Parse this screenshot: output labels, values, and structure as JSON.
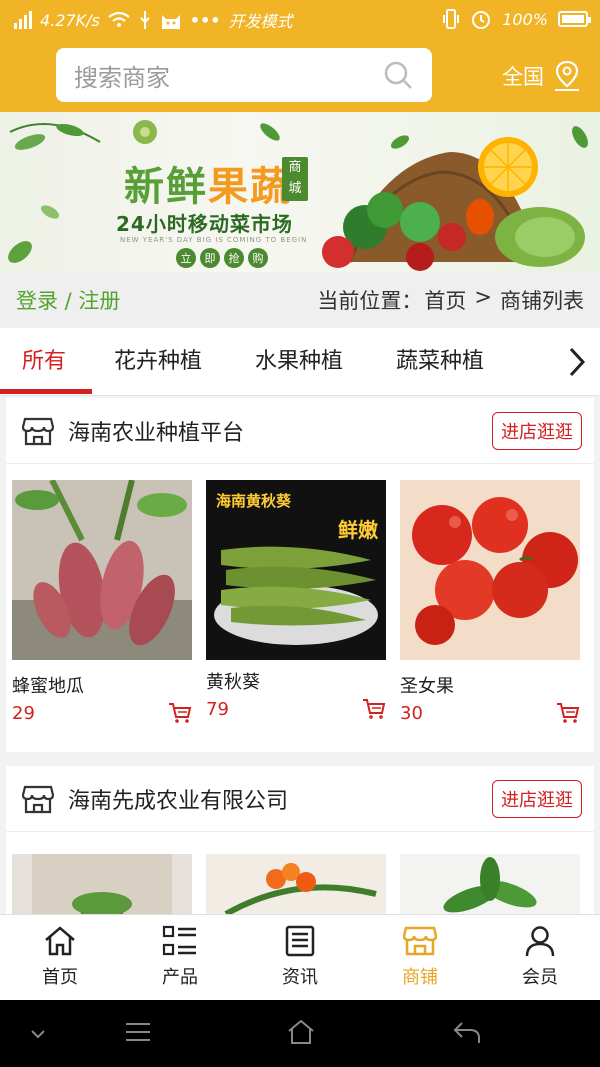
{
  "status": {
    "speed": "4.27K/s",
    "dev_mode": "开发模式",
    "battery": "100%"
  },
  "header": {
    "search_placeholder": "搜索商家",
    "region": "全国"
  },
  "banner": {
    "title_a": "新鲜",
    "title_b": "果蔬",
    "badge_a": "商",
    "badge_b": "城",
    "subtitle": "24小时移动菜市场",
    "en": "NEW YEAR'S DAY BIG IS COMING TO BEGIN",
    "buttons": [
      "立",
      "即",
      "抢",
      "购"
    ]
  },
  "breadcrumb": {
    "login": "登录 / 注册",
    "prefix": "当前位置：",
    "home": "首页",
    "sep": ">",
    "current": "商铺列表"
  },
  "tabs": [
    "所有",
    "花卉种植",
    "水果种植",
    "蔬菜种植"
  ],
  "shops": [
    {
      "name": "海南农业种植平台",
      "enter": "进店逛逛",
      "products": [
        {
          "name": "蜂蜜地瓜",
          "price": "29"
        },
        {
          "name": "黄秋葵",
          "price": "79",
          "tag_a": "海南黄秋葵",
          "tag_b": "鲜嫩"
        },
        {
          "name": "圣女果",
          "price": "30"
        }
      ]
    },
    {
      "name": "海南先成农业有限公司",
      "enter": "进店逛逛"
    }
  ],
  "nav": [
    {
      "label": "首页",
      "icon": "home-icon"
    },
    {
      "label": "产品",
      "icon": "list-icon"
    },
    {
      "label": "资讯",
      "icon": "news-icon"
    },
    {
      "label": "商铺",
      "icon": "shop-icon"
    },
    {
      "label": "会员",
      "icon": "user-icon"
    }
  ],
  "colors": {
    "brand": "#f0b426",
    "accent_red": "#d32020",
    "green": "#55a32e"
  }
}
